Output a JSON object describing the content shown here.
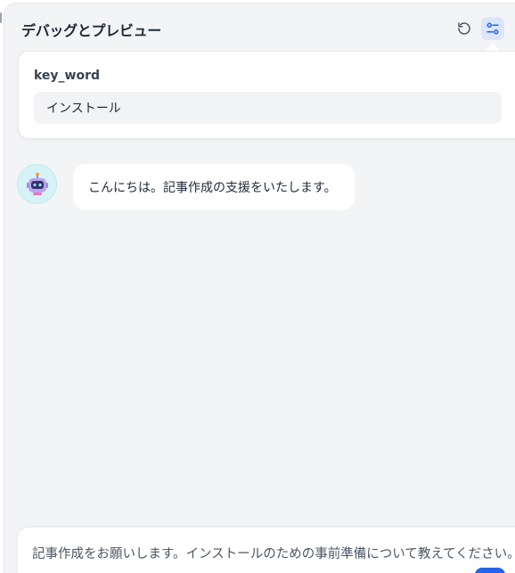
{
  "header": {
    "title": "デバッグとプレビュー",
    "icons": [
      "reset-icon",
      "settings-sliders-icon"
    ]
  },
  "variables": {
    "label": "key_word",
    "value": "インストール"
  },
  "chat": {
    "bot_message": "こんにちは。記事作成の支援をいたします。",
    "avatar_icon": "robot-icon"
  },
  "composer": {
    "text": "記事作成をお願いします。インストールのための事前準備について教えてください。"
  },
  "colors": {
    "panel_bg": "#f3f4f6",
    "accent": "#2563eb",
    "avatar_bg": "#d5f3f5"
  }
}
